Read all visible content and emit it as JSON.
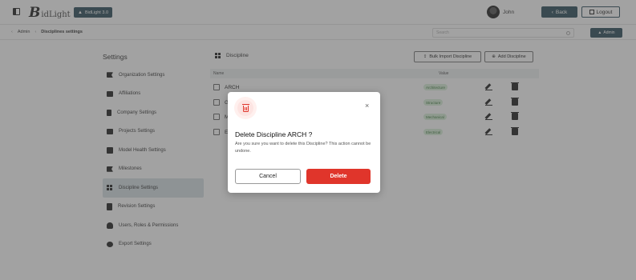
{
  "topbar": {
    "logo_mark": "B",
    "logo_text": "idLight",
    "version_label": "BidLight 3.0",
    "user_name": "John",
    "back_label": "Back",
    "logout_label": "Logout"
  },
  "breadcrumb": {
    "items": [
      "Admin",
      "Disciplines settings"
    ]
  },
  "search": {
    "placeholder": "Search"
  },
  "role_label": "Admin",
  "settings": {
    "title": "Settings",
    "menu": [
      {
        "label": "Organization Settings",
        "icon": "flag-icon"
      },
      {
        "label": "Affiliations",
        "icon": "card-icon"
      },
      {
        "label": "Company Settings",
        "icon": "building-icon"
      },
      {
        "label": "Projects Settings",
        "icon": "folder-icon"
      },
      {
        "label": "Model Health Settings",
        "icon": "health-icon"
      },
      {
        "label": "Milestones",
        "icon": "flag-icon"
      },
      {
        "label": "Discipline Settings",
        "icon": "grid-icon",
        "active": true
      },
      {
        "label": "Revision Settings",
        "icon": "clipboard-icon"
      },
      {
        "label": "Users, Roles & Permissions",
        "icon": "users-icon"
      },
      {
        "label": "Export Settings",
        "icon": "gear-icon"
      }
    ]
  },
  "panel": {
    "title": "Discipline",
    "bulk_label": "Bulk Import Discipline",
    "add_label": "Add Discipline",
    "columns": [
      "Name",
      "Value"
    ],
    "rows": [
      {
        "name": "ARCH",
        "value": "Architecture"
      },
      {
        "name": "G",
        "value": "Structure"
      },
      {
        "name": "M",
        "value": "Mechanical"
      },
      {
        "name": "E",
        "value": "Electrical"
      }
    ]
  },
  "modal": {
    "title": "Delete Discipline ARCH ?",
    "message": "Are you sure you want to delete this Discipline? This action cannot be undone.",
    "cancel_label": "Cancel",
    "delete_label": "Delete",
    "close_glyph": "×"
  },
  "colors": {
    "brand": "#2e4f5c",
    "danger": "#e0352b",
    "active_menu": "#d6e1e5"
  }
}
